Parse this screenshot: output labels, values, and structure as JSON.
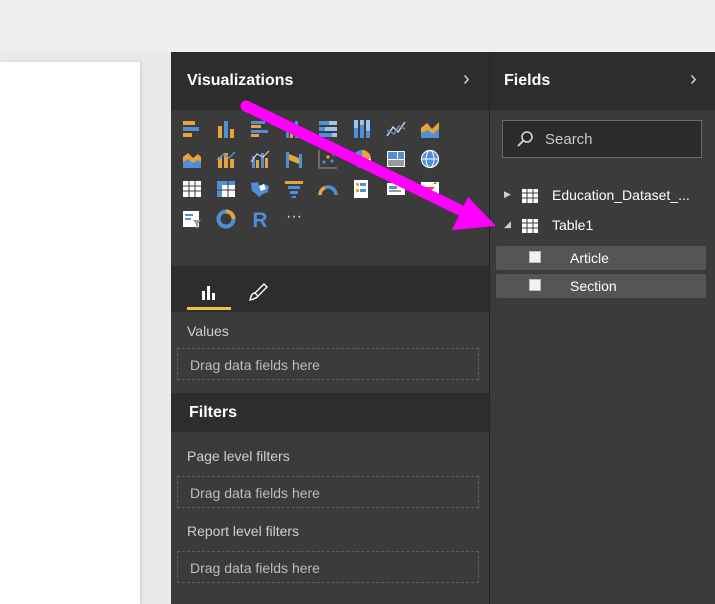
{
  "visualizations": {
    "title": "Visualizations",
    "icons": [
      "stacked-bar-chart-icon",
      "stacked-column-chart-icon",
      "clustered-bar-chart-icon",
      "clustered-column-chart-icon",
      "100-percent-stacked-bar-chart-icon",
      "100-percent-stacked-column-chart-icon",
      "line-chart-icon",
      "area-chart-icon",
      "stacked-area-chart-icon",
      "line-and-stacked-column-chart-icon",
      "line-and-clustered-column-chart-icon",
      "ribbon-chart-icon",
      "scatter-chart-icon",
      "pie-chart-icon",
      "treemap-icon",
      "map-icon",
      "table-icon",
      "matrix-icon",
      "filled-map-icon",
      "funnel-icon",
      "gauge-icon",
      "multi-row-card-icon",
      "card-icon",
      "kpi-icon",
      "slicer-icon",
      "donut-chart-icon",
      "r-script-visual-icon",
      "more-visuals-icon"
    ],
    "more_label": "···",
    "r_label": "R",
    "tabs": {
      "fields_tab": "fields-tab-icon",
      "format_tab": "paint-brush-icon"
    },
    "values_label": "Values",
    "values_placeholder": "Drag data fields here"
  },
  "filters": {
    "title": "Filters",
    "page_level_label": "Page level filters",
    "page_level_placeholder": "Drag data fields here",
    "report_level_label": "Report level filters",
    "report_level_placeholder": "Drag data fields here"
  },
  "fields": {
    "title": "Fields",
    "search_placeholder": "Search",
    "tables": [
      {
        "name": "Education_Dataset_...",
        "expanded": false
      },
      {
        "name": "Table1",
        "expanded": true,
        "fields": [
          "Article",
          "Section"
        ]
      }
    ]
  },
  "colors": {
    "pane_bg": "#3b3b3b",
    "header_bg": "#2d2d2d",
    "accent_yellow": "#e8c53a",
    "annotation_arrow": "#ff00ff"
  }
}
